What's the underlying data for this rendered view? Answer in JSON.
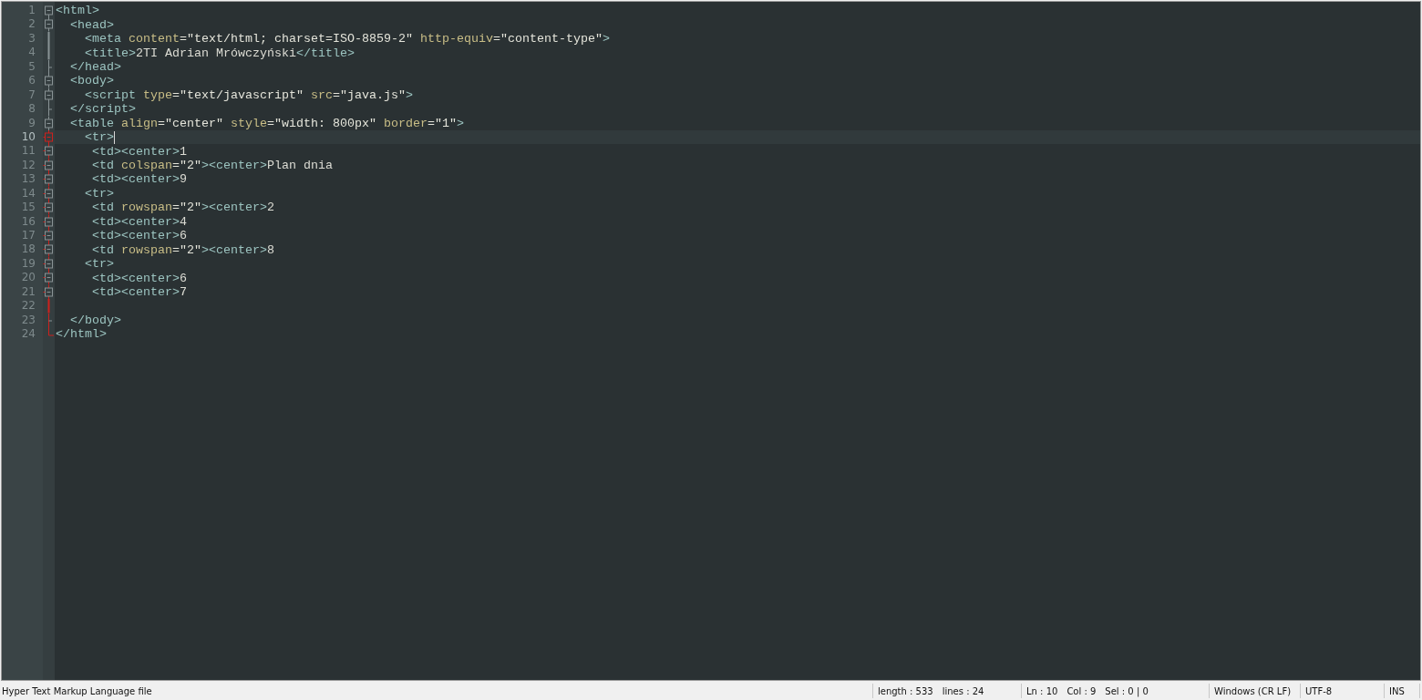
{
  "editor": {
    "lines": [
      {
        "number": "1",
        "kind": "box",
        "highlight": false,
        "selected": false,
        "tokens": [
          {
            "kind": "tag",
            "text": "<html>"
          }
        ]
      },
      {
        "number": "2",
        "kind": "box",
        "highlight": false,
        "selected": false,
        "tokens": [
          {
            "kind": "tag",
            "text": "  <head>"
          }
        ]
      },
      {
        "number": "3",
        "kind": "line",
        "highlight": false,
        "selected": false,
        "tokens": [
          {
            "kind": "tag",
            "text": "    <meta"
          },
          {
            "kind": "attr",
            "text": " content"
          },
          {
            "kind": "value",
            "text": "=\"text/html; charset=ISO-8859-2\""
          },
          {
            "kind": "attr",
            "text": " http-equiv"
          },
          {
            "kind": "value",
            "text": "=\"content-type\""
          },
          {
            "kind": "tag",
            "text": ">"
          }
        ]
      },
      {
        "number": "4",
        "kind": "line",
        "highlight": false,
        "selected": false,
        "tokens": [
          {
            "kind": "tag",
            "text": "    <title>"
          },
          {
            "kind": "text",
            "text": "2TI Adrian Mrówczyński"
          },
          {
            "kind": "tag",
            "text": "</title>"
          }
        ]
      },
      {
        "number": "5",
        "kind": "end",
        "highlight": false,
        "selected": false,
        "tokens": [
          {
            "kind": "tag",
            "text": "  </head>"
          }
        ]
      },
      {
        "number": "6",
        "kind": "box",
        "highlight": false,
        "selected": false,
        "tokens": [
          {
            "kind": "tag",
            "text": "  <body>"
          }
        ]
      },
      {
        "number": "7",
        "kind": "box",
        "highlight": false,
        "selected": false,
        "tokens": [
          {
            "kind": "tag",
            "text": "    <script"
          },
          {
            "kind": "attr",
            "text": " type"
          },
          {
            "kind": "value",
            "text": "=\"text/javascript\""
          },
          {
            "kind": "attr",
            "text": " src"
          },
          {
            "kind": "value",
            "text": "=\"java.js\""
          },
          {
            "kind": "tag",
            "text": ">"
          }
        ]
      },
      {
        "number": "8",
        "kind": "end",
        "highlight": false,
        "selected": false,
        "tokens": [
          {
            "kind": "tag",
            "text": "  </script>"
          }
        ]
      },
      {
        "number": "9",
        "kind": "box",
        "highlight": false,
        "selected": false,
        "tokens": [
          {
            "kind": "tag",
            "text": "  <table"
          },
          {
            "kind": "attr",
            "text": " align"
          },
          {
            "kind": "value",
            "text": "=\"center\""
          },
          {
            "kind": "attr",
            "text": " style"
          },
          {
            "kind": "value",
            "text": "=\"width: 800px\""
          },
          {
            "kind": "attr",
            "text": " border"
          },
          {
            "kind": "value",
            "text": "=\"1\""
          },
          {
            "kind": "tag",
            "text": ">"
          }
        ]
      },
      {
        "number": "10",
        "kind": "box",
        "highlight": true,
        "selected": true,
        "tokens": [
          {
            "kind": "tag",
            "text": "    <tr>"
          },
          {
            "kind": "caret"
          }
        ]
      },
      {
        "number": "11",
        "kind": "box",
        "highlight": true,
        "selected": false,
        "tokens": [
          {
            "kind": "tag",
            "text": "     <td><center>"
          },
          {
            "kind": "text",
            "text": "1"
          }
        ]
      },
      {
        "number": "12",
        "kind": "box",
        "highlight": true,
        "selected": false,
        "tokens": [
          {
            "kind": "tag",
            "text": "     <td"
          },
          {
            "kind": "attr",
            "text": " colspan"
          },
          {
            "kind": "value",
            "text": "=\"2\""
          },
          {
            "kind": "tag",
            "text": "><center>"
          },
          {
            "kind": "text",
            "text": "Plan dnia"
          }
        ]
      },
      {
        "number": "13",
        "kind": "box",
        "highlight": true,
        "selected": false,
        "tokens": [
          {
            "kind": "tag",
            "text": "     <td><center>"
          },
          {
            "kind": "text",
            "text": "9"
          }
        ]
      },
      {
        "number": "14",
        "kind": "box",
        "highlight": true,
        "selected": false,
        "tokens": [
          {
            "kind": "tag",
            "text": "    <tr>"
          }
        ]
      },
      {
        "number": "15",
        "kind": "box",
        "highlight": true,
        "selected": false,
        "tokens": [
          {
            "kind": "tag",
            "text": "     <td"
          },
          {
            "kind": "attr",
            "text": " rowspan"
          },
          {
            "kind": "value",
            "text": "=\"2\""
          },
          {
            "kind": "tag",
            "text": "><center>"
          },
          {
            "kind": "text",
            "text": "2"
          }
        ]
      },
      {
        "number": "16",
        "kind": "box",
        "highlight": true,
        "selected": false,
        "tokens": [
          {
            "kind": "tag",
            "text": "     <td><center>"
          },
          {
            "kind": "text",
            "text": "4"
          }
        ]
      },
      {
        "number": "17",
        "kind": "box",
        "highlight": true,
        "selected": false,
        "tokens": [
          {
            "kind": "tag",
            "text": "     <td><center>"
          },
          {
            "kind": "text",
            "text": "6"
          }
        ]
      },
      {
        "number": "18",
        "kind": "box",
        "highlight": true,
        "selected": false,
        "tokens": [
          {
            "kind": "tag",
            "text": "     <td"
          },
          {
            "kind": "attr",
            "text": " rowspan"
          },
          {
            "kind": "value",
            "text": "=\"2\""
          },
          {
            "kind": "tag",
            "text": "><center>"
          },
          {
            "kind": "text",
            "text": "8"
          }
        ]
      },
      {
        "number": "19",
        "kind": "box",
        "highlight": true,
        "selected": false,
        "tokens": [
          {
            "kind": "tag",
            "text": "    <tr>"
          }
        ]
      },
      {
        "number": "20",
        "kind": "box",
        "highlight": true,
        "selected": false,
        "tokens": [
          {
            "kind": "tag",
            "text": "     <td><center>"
          },
          {
            "kind": "text",
            "text": "6"
          }
        ]
      },
      {
        "number": "21",
        "kind": "box",
        "highlight": true,
        "selected": false,
        "tokens": [
          {
            "kind": "tag",
            "text": "     <td><center>"
          },
          {
            "kind": "text",
            "text": "7"
          }
        ]
      },
      {
        "number": "22",
        "kind": "line",
        "highlight": true,
        "selected": false
      },
      {
        "number": "23",
        "kind": "end",
        "highlight": true,
        "selected": false,
        "tokens": [
          {
            "kind": "tag",
            "text": "  </body>"
          }
        ]
      },
      {
        "number": "24",
        "kind": "corner",
        "highlight": true,
        "selected": false,
        "tokens": [
          {
            "kind": "tag",
            "text": "</html>"
          }
        ]
      }
    ]
  },
  "status_bar": {
    "file_type": "Hyper Text Markup Language file",
    "sections": [
      [
        "length : 533",
        "lines : 24"
      ],
      [
        "Ln : 10",
        "Col : 9",
        "Sel : 0 | 0"
      ],
      [
        "Windows (CR LF)"
      ],
      [
        "UTF-8"
      ],
      [
        "INS"
      ]
    ]
  }
}
